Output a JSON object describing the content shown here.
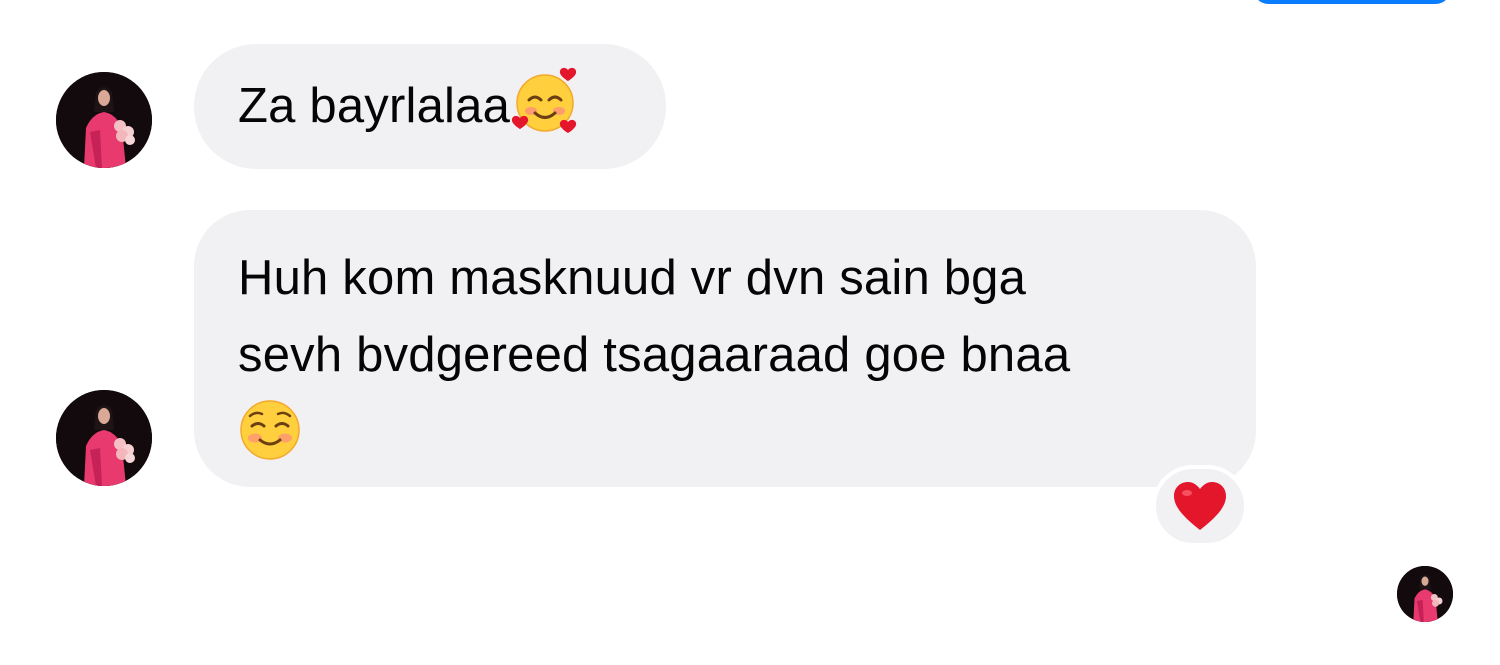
{
  "messages": [
    {
      "text": "Za bayrlalaa",
      "emoji": "smiling-face-with-hearts"
    },
    {
      "lines": [
        "Huh kom masknuud vr dvn sain bga",
        "sevh bvdgereed tsagaaraad goe bnaa"
      ],
      "emoji": "smiling-face"
    }
  ],
  "reaction": {
    "emoji": "red-heart",
    "color": "#e3162b"
  },
  "colors": {
    "incoming_bubble": "#f1f1f4",
    "accent": "#0a7cff"
  }
}
